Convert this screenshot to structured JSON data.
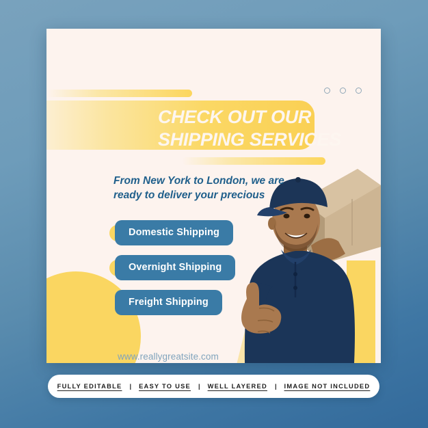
{
  "background": {
    "gradient_from": "#79a2bd",
    "gradient_to": "#336a9b"
  },
  "card": {
    "background_color": "#fdf3ee",
    "accent_yellow": "#fad661",
    "accent_blue": "#3a7ba6",
    "heading": {
      "line1": "CHECK OUT OUR",
      "line2": "SHIPPING SERVICES",
      "color": "#fdf6f0"
    },
    "subtitle": {
      "line1": "From New York to London, we are",
      "line2": "ready to deliver your precious",
      "color": "#1f5f8b"
    },
    "window_dots": [
      {
        "name": "window-dot-1"
      },
      {
        "name": "window-dot-2"
      },
      {
        "name": "window-dot-3"
      }
    ],
    "services": [
      {
        "label": "Domestic Shipping"
      },
      {
        "label": "Overnight Shipping"
      },
      {
        "label": "Freight Shipping"
      }
    ],
    "website": "www.reallygreatsite.com",
    "photo": {
      "alt": "Smiling delivery man in navy cap and polo shirt carrying a cardboard box on his shoulder and giving a thumbs up",
      "cap_color": "#1c3557",
      "shirt_color": "#1b3558",
      "box_color": "#c0a887",
      "skin_color": "#a9794f"
    }
  },
  "info_bar": {
    "items": [
      {
        "label": "FULLY EDITABLE"
      },
      {
        "label": "EASY TO USE"
      },
      {
        "label": "WELL LAYERED"
      },
      {
        "label": "IMAGE NOT INCLUDED"
      }
    ],
    "separator": "|"
  }
}
